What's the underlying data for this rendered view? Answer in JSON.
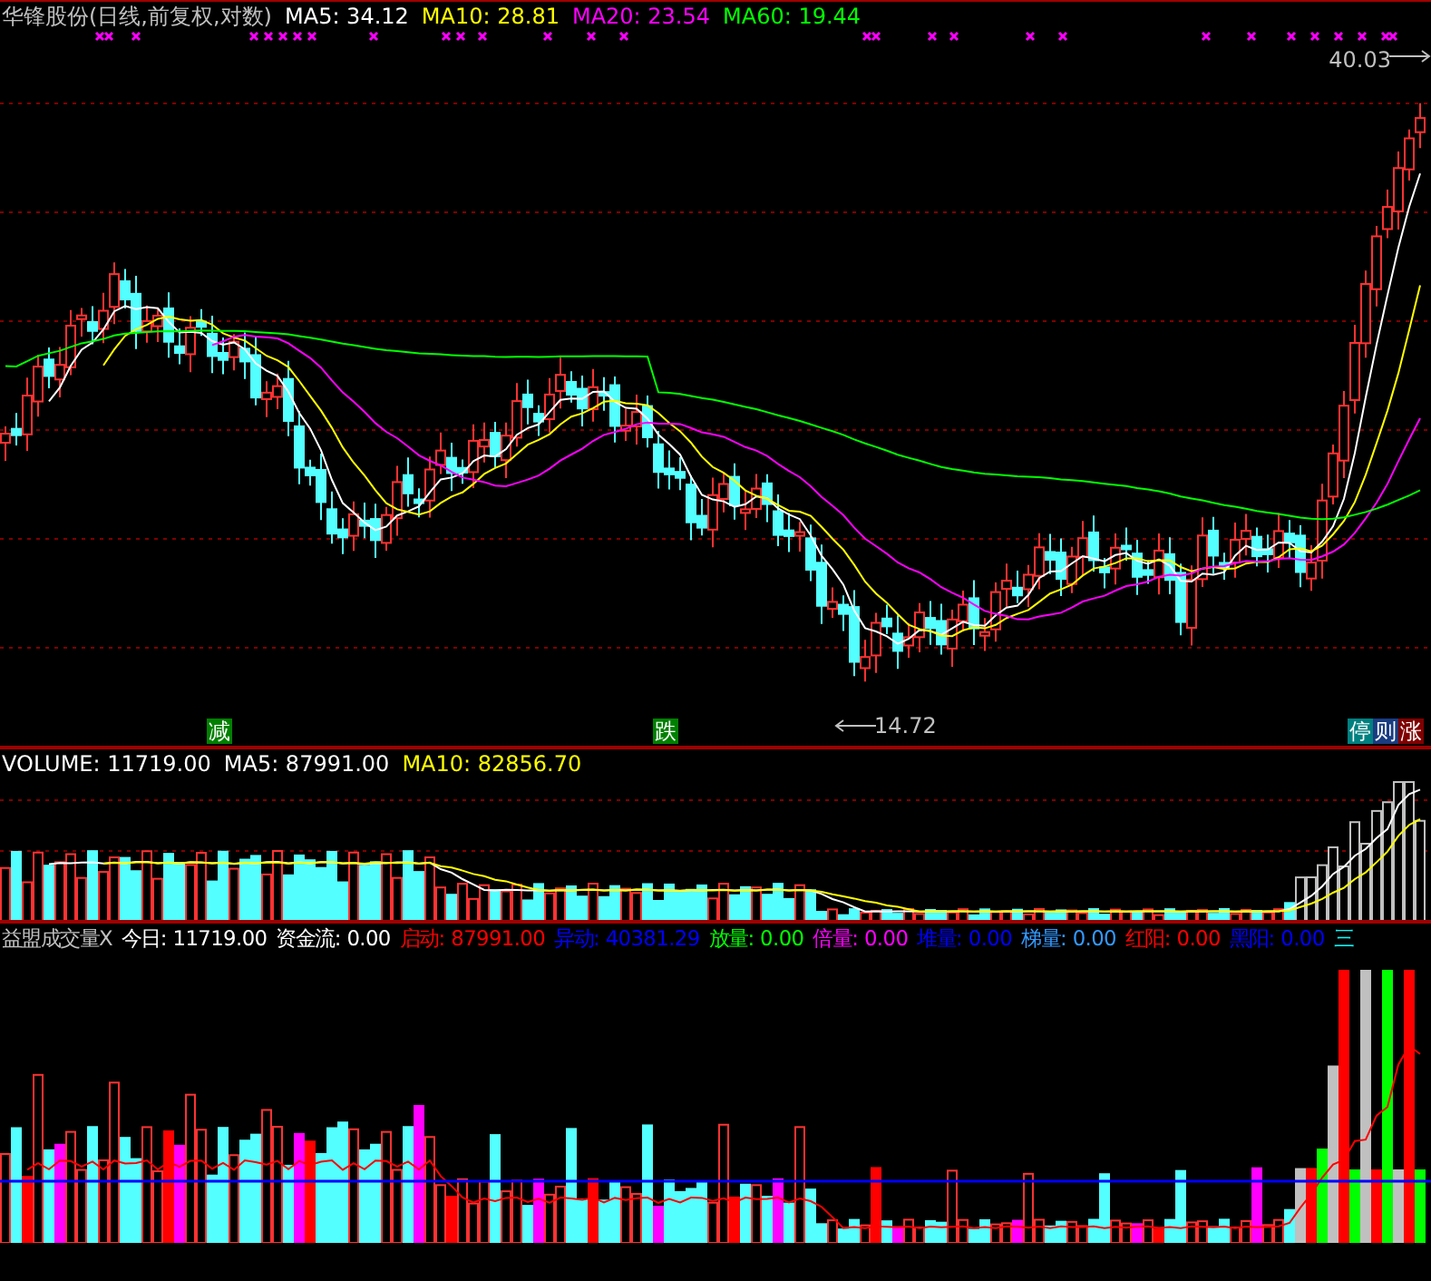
{
  "price_panel": {
    "title": "华锋股份(日线,前复权,对数)",
    "legend": [
      {
        "label": "MA5: 34.12",
        "color": "#ffffff"
      },
      {
        "label": "MA10: 28.81",
        "color": "#ffff00"
      },
      {
        "label": "MA20: 23.54",
        "color": "#ff00ff"
      },
      {
        "label": "MA60: 19.44",
        "color": "#00ff00"
      }
    ],
    "annotations": [
      {
        "kind": "high",
        "text": "40.03"
      },
      {
        "kind": "low",
        "text": "14.72"
      }
    ],
    "badges": [
      {
        "text": "减",
        "color": "#008000"
      },
      {
        "text": "跌",
        "color": "#008000"
      },
      {
        "text": "停",
        "color": "#008080"
      },
      {
        "text": "则",
        "color": "#1a3c80"
      },
      {
        "text": "涨",
        "color": "#800000"
      }
    ]
  },
  "volume_panel": {
    "legend": [
      {
        "label": "VOLUME: 11719.00",
        "color": "#ffffff"
      },
      {
        "label": "MA5: 87991.00",
        "color": "#ffffff"
      },
      {
        "label": "MA10: 82856.70",
        "color": "#ffff00"
      }
    ]
  },
  "indicator_panel": {
    "legend": [
      {
        "label": "益盟成交量X",
        "color": "#c0c0c0"
      },
      {
        "label": "今日: 11719.00",
        "color": "#ffffff"
      },
      {
        "label": "资金流: 0.00",
        "color": "#ffffff"
      },
      {
        "label": "启动: 87991.00",
        "color": "#ff0000"
      },
      {
        "label": "异动: 40381.29",
        "color": "#0000ff"
      },
      {
        "label": "放量: 0.00",
        "color": "#00ff00"
      },
      {
        "label": "倍量: 0.00",
        "color": "#ff00ff"
      },
      {
        "label": "堆量: 0.00",
        "color": "#0000ff"
      },
      {
        "label": "梯量: 0.00",
        "color": "#3399ff"
      },
      {
        "label": "红阳: 0.00",
        "color": "#ff0000"
      },
      {
        "label": "黑阳: 0.00",
        "color": "#0000ff"
      },
      {
        "label": "三",
        "color": "#00ffff"
      }
    ]
  }
}
